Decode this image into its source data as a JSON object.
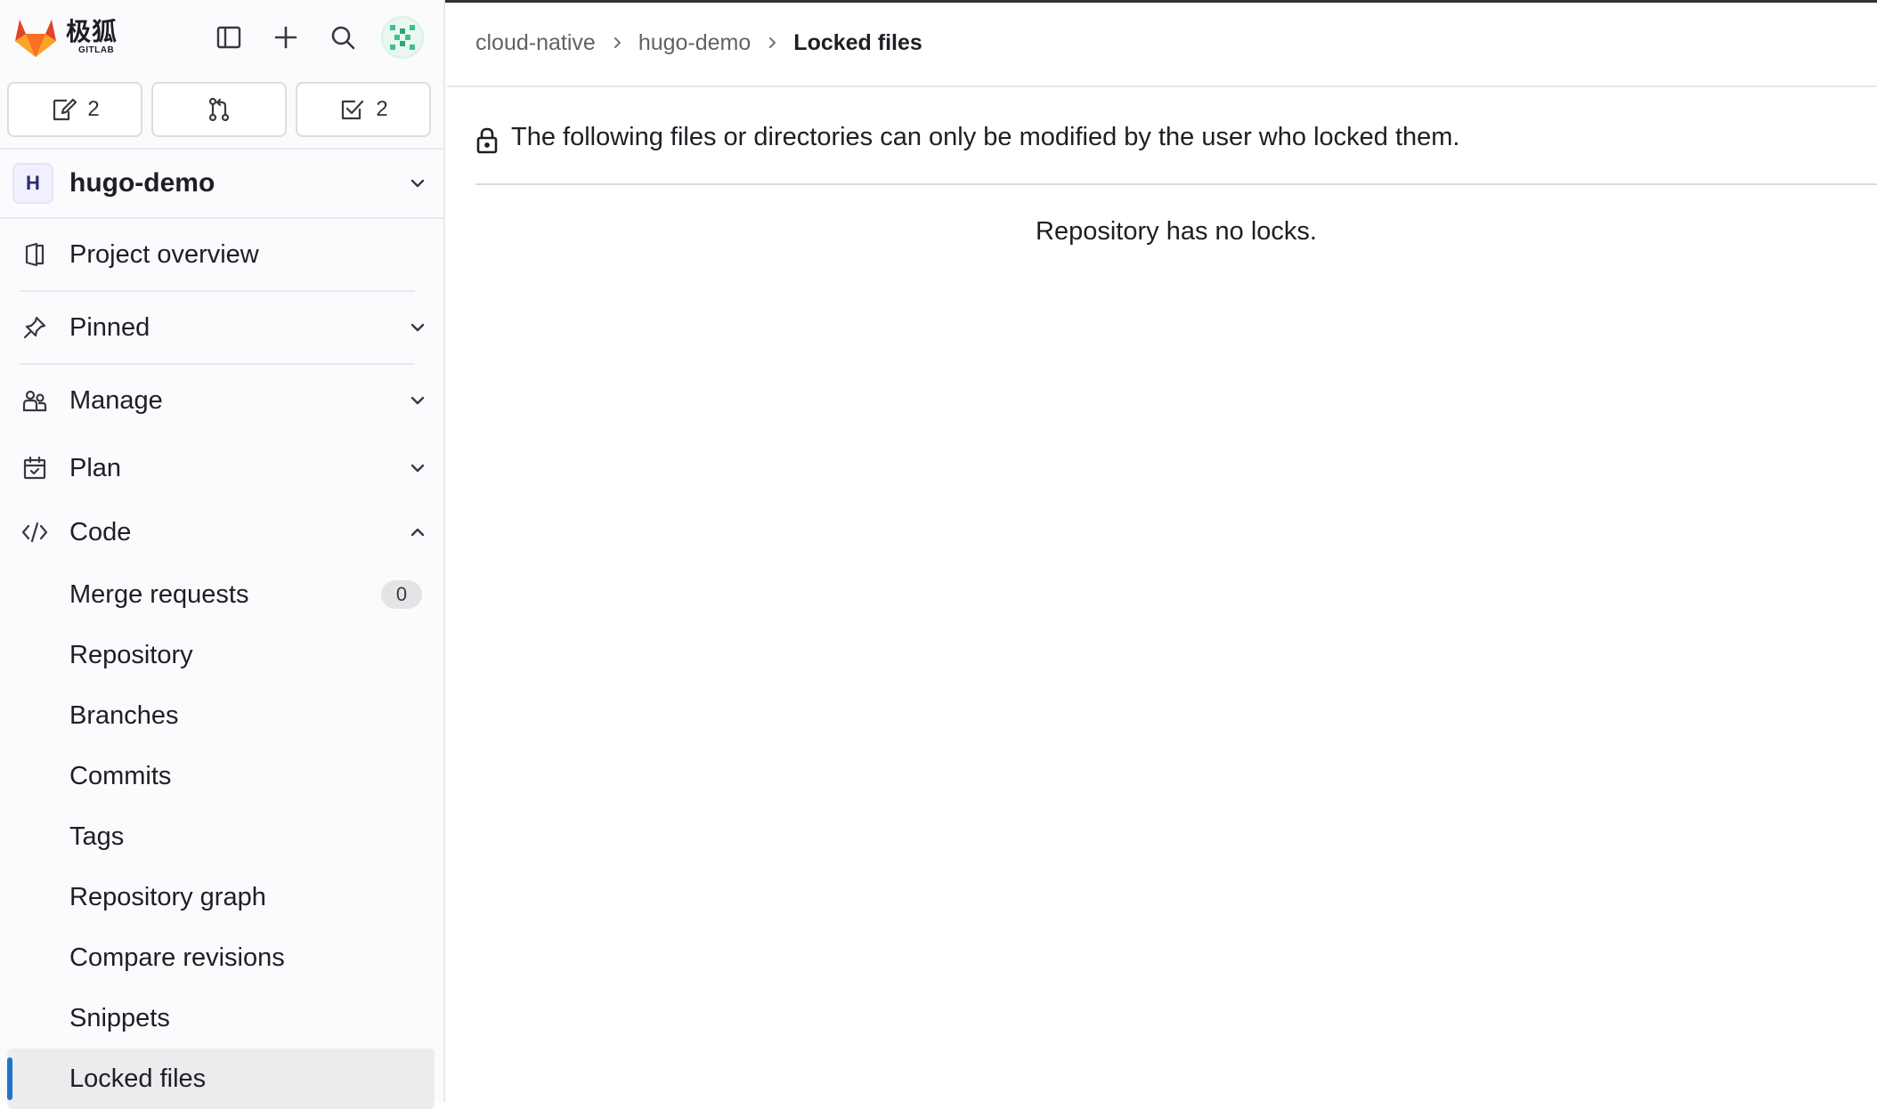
{
  "brand": {
    "name": "极狐",
    "sub": "GITLAB"
  },
  "counters": [
    {
      "icon": "issues-icon",
      "value": "2"
    },
    {
      "icon": "merge-request-icon",
      "value": ""
    },
    {
      "icon": "todo-icon",
      "value": "2"
    }
  ],
  "project": {
    "badge": "H",
    "name": "hugo-demo"
  },
  "nav": {
    "project_overview": "Project overview",
    "pinned": "Pinned",
    "manage": "Manage",
    "plan": "Plan",
    "code": "Code"
  },
  "code_items": [
    {
      "label": "Merge requests",
      "count": "0"
    },
    {
      "label": "Repository"
    },
    {
      "label": "Branches"
    },
    {
      "label": "Commits"
    },
    {
      "label": "Tags"
    },
    {
      "label": "Repository graph"
    },
    {
      "label": "Compare revisions"
    },
    {
      "label": "Snippets"
    },
    {
      "label": "Locked files"
    }
  ],
  "breadcrumb": [
    "cloud-native",
    "hugo-demo",
    "Locked files"
  ],
  "notice": "The following files or directories can only be modified by the user who locked them.",
  "empty_state": "Repository has no locks.",
  "colors": {
    "accent": "#1f75cb",
    "logo_orange": "#e24329",
    "sidebar_bg": "#fbfafd"
  }
}
